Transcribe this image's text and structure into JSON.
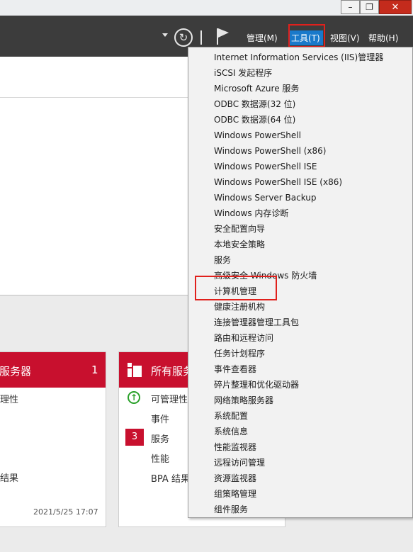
{
  "window_controls": {
    "minimize": "–",
    "maximize": "❐",
    "close": "✕"
  },
  "menubar": {
    "manage": "管理(M)",
    "tools": "工具(T)",
    "view": "视图(V)",
    "help": "帮助(H)"
  },
  "tools_menu": {
    "items": [
      "Internet Information Services (IIS)管理器",
      "iSCSI 发起程序",
      "Microsoft Azure 服务",
      "ODBC 数据源(32 位)",
      "ODBC 数据源(64 位)",
      "Windows PowerShell",
      "Windows PowerShell (x86)",
      "Windows PowerShell ISE",
      "Windows PowerShell ISE (x86)",
      "Windows Server Backup",
      "Windows 内存诊断",
      "安全配置向导",
      "本地安全策略",
      "服务",
      "高级安全 Windows 防火墙",
      "计算机管理",
      "健康注册机构",
      "连接管理器管理工具包",
      "路由和远程访问",
      "任务计划程序",
      "事件查看器",
      "碎片整理和优化驱动器",
      "网络策略服务器",
      "系统配置",
      "系统信息",
      "性能监视器",
      "远程访问管理",
      "资源监视器",
      "组策略管理",
      "组件服务"
    ]
  },
  "tile_left": {
    "title": "服务器",
    "count": "1",
    "rows": [
      "理性",
      "结果"
    ],
    "timestamp": "2021/5/25 17:07"
  },
  "tile_right": {
    "title": "所有服务",
    "rows": [
      "可管理性",
      "事件",
      "服务",
      "性能",
      "BPA 结果"
    ],
    "badge": "3"
  },
  "colors": {
    "accent_red": "#c8102e",
    "menu_blue": "#1979ca",
    "toolbar": "#3c3c3c",
    "highlight_box": "#e0201c"
  }
}
